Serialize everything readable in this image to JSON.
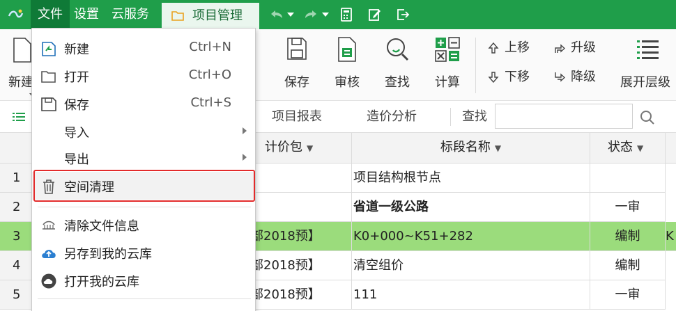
{
  "menubar": {
    "items": [
      {
        "label": "文件"
      },
      {
        "label": "设置"
      },
      {
        "label": "云服务"
      }
    ],
    "project_tab": "项目管理",
    "colors": {
      "bar": "#1f9e4a",
      "active": "#0f7a37"
    }
  },
  "ribbon": {
    "partial_left_label": "新建",
    "save": "保存",
    "audit": "审核",
    "find": "查找",
    "calc": "计算",
    "move_up": "上移",
    "move_down": "下移",
    "upgrade": "升级",
    "downgrade": "降级",
    "expand": "展开层级"
  },
  "tabs": {
    "report": "项目报表",
    "cost_analysis": "造价分析",
    "search_label": "查找",
    "search_value": ""
  },
  "grid": {
    "headers": {
      "pkg": "计价包",
      "name": "标段名称",
      "status": "状态"
    },
    "rows": [
      {
        "num": "1",
        "pkg": "",
        "name": "项目结构根节点",
        "status": "",
        "bold": false
      },
      {
        "num": "2",
        "pkg": "",
        "name": "省道一级公路",
        "status": "一审",
        "bold": true
      },
      {
        "num": "3",
        "pkg": "部2018预】",
        "name": "K0+000~K51+282",
        "status": "编制",
        "extra": "K"
      },
      {
        "num": "4",
        "pkg": "部2018预】",
        "name": "清空组价",
        "status": "编制"
      },
      {
        "num": "5",
        "pkg": "部2018预】",
        "name": "111",
        "status": "一审"
      }
    ]
  },
  "file_menu": {
    "new": {
      "label": "新建",
      "shortcut": "Ctrl+N"
    },
    "open": {
      "label": "打开",
      "shortcut": "Ctrl+O"
    },
    "save": {
      "label": "保存",
      "shortcut": "Ctrl+S"
    },
    "import": {
      "label": "导入"
    },
    "export": {
      "label": "导出"
    },
    "cleanup": {
      "label": "空间清理"
    },
    "clear_info": {
      "label": "清除文件信息"
    },
    "save_cloud": {
      "label": "另存到我的云库"
    },
    "open_cloud": {
      "label": "打开我的云库"
    }
  },
  "highlight_color": "#e32b2b",
  "selected_row_color": "#9bdc7c"
}
